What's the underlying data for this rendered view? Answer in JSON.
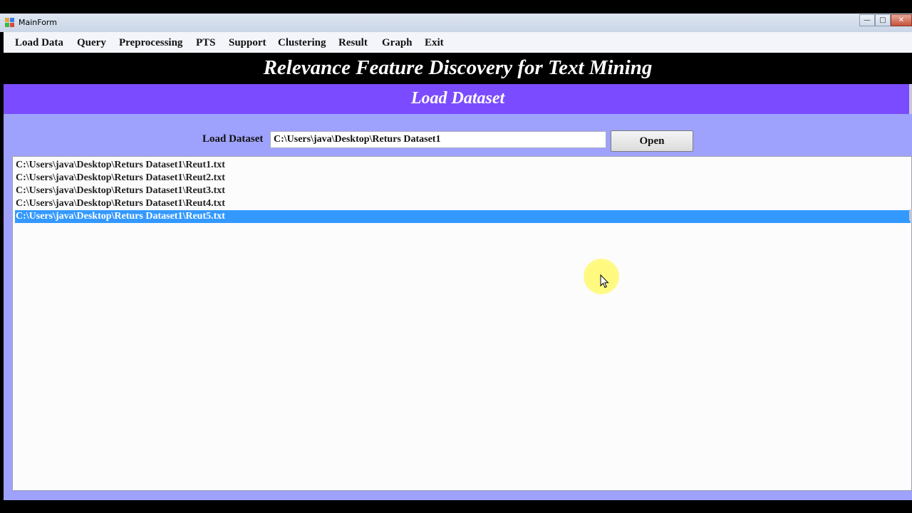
{
  "window": {
    "title": "MainForm",
    "controls": {
      "minimize": "—",
      "maximize": "□",
      "close": "✕"
    }
  },
  "menu": {
    "items": [
      "Load Data",
      "Query",
      "Preprocessing",
      "PTS",
      "Support",
      "Clustering",
      "Result",
      "Graph",
      "Exit"
    ]
  },
  "header": {
    "title": "Relevance Feature Discovery for Text Mining",
    "subtitle": "Load Dataset"
  },
  "form": {
    "label": "Load Dataset",
    "path_value": "C:\\Users\\java\\Desktop\\Returs Dataset1",
    "open_label": "Open"
  },
  "file_list": {
    "items": [
      "C:\\Users\\java\\Desktop\\Returs Dataset1\\Reut1.txt",
      "C:\\Users\\java\\Desktop\\Returs Dataset1\\Reut2.txt",
      "C:\\Users\\java\\Desktop\\Returs Dataset1\\Reut3.txt",
      "C:\\Users\\java\\Desktop\\Returs Dataset1\\Reut4.txt",
      "C:\\Users\\java\\Desktop\\Returs Dataset1\\Reut5.txt"
    ],
    "selected_index": 4
  },
  "colors": {
    "banner_bg": "#000000",
    "subbanner_bg": "#7b4cff",
    "panel_bg": "#9ea2fc",
    "selection": "#3399ff"
  }
}
